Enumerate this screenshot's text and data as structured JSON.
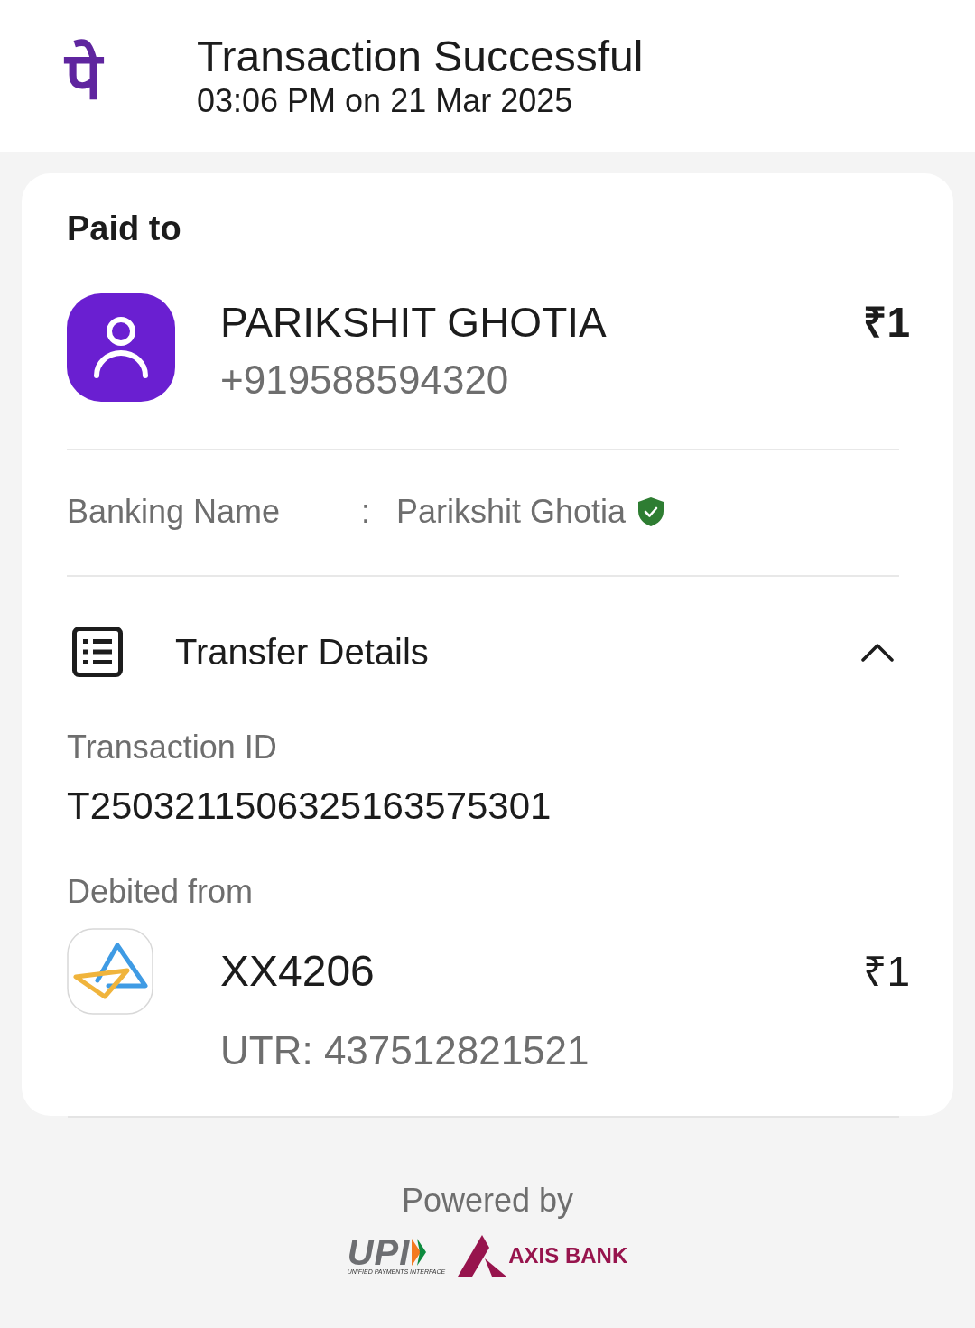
{
  "header": {
    "logo_text": "पे",
    "title": "Transaction Successful",
    "timestamp": "03:06 PM on 21 Mar 2025"
  },
  "paid_to": {
    "heading": "Paid to",
    "payee_name": "PARIKSHIT GHOTIA",
    "payee_phone": "+919588594320",
    "amount": "₹1"
  },
  "banking_name": {
    "label": "Banking Name",
    "separator": ":",
    "value": "Parikshit Ghotia",
    "verified": true
  },
  "transfer_details": {
    "title": "Transfer Details",
    "expanded": true,
    "transaction_id_label": "Transaction ID",
    "transaction_id": "T2503211506325163575301",
    "debited_from_label": "Debited from",
    "account": "XX4206",
    "amount": "₹1",
    "utr": "UTR: 437512821521"
  },
  "footer": {
    "powered_by": "Powered by",
    "logos": [
      {
        "kind": "upi",
        "text": "UPI",
        "subtext": "UNIFIED PAYMENTS INTERFACE"
      },
      {
        "kind": "axis",
        "text": "AXIS BANK"
      }
    ]
  }
}
